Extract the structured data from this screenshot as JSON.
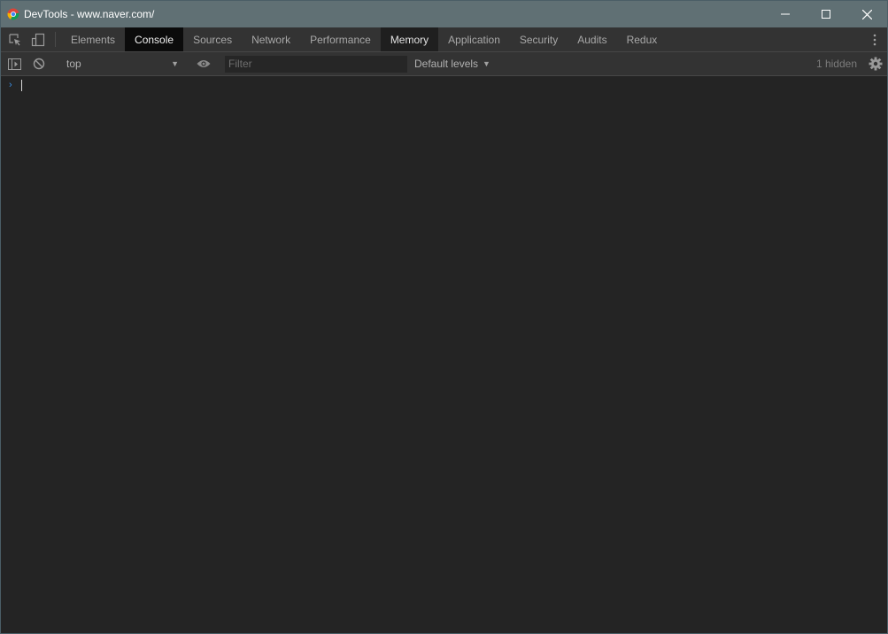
{
  "window": {
    "title": "DevTools - www.naver.com/",
    "controls": [
      "minimize-icon",
      "maximize-icon",
      "close-icon"
    ]
  },
  "toolbar": {
    "inspect_icon": "inspect-element-icon",
    "device_icon": "device-toolbar-icon",
    "tabs": [
      {
        "label": "Elements",
        "state": "normal"
      },
      {
        "label": "Console",
        "state": "active"
      },
      {
        "label": "Sources",
        "state": "normal"
      },
      {
        "label": "Network",
        "state": "normal"
      },
      {
        "label": "Performance",
        "state": "normal"
      },
      {
        "label": "Memory",
        "state": "highlight"
      },
      {
        "label": "Application",
        "state": "normal"
      },
      {
        "label": "Security",
        "state": "normal"
      },
      {
        "label": "Audits",
        "state": "normal"
      },
      {
        "label": "Redux",
        "state": "normal"
      }
    ],
    "menu_icon": "more-vertical-icon"
  },
  "console_toolbar": {
    "sidebar_icon": "show-sidebar-icon",
    "clear_icon": "clear-console-icon",
    "context": "top",
    "eye_icon": "live-expression-icon",
    "filter_placeholder": "Filter",
    "filter_value": "",
    "levels": "Default levels",
    "hidden": "1 hidden",
    "settings_icon": "gear-icon"
  },
  "console": {
    "prompt_symbol": "›",
    "input": ""
  },
  "colors": {
    "titlebar": "#607074",
    "toolbar": "#333333",
    "console_bg": "#242424",
    "active_tab": "#0b0b0b",
    "prompt": "#3a8ee0"
  }
}
